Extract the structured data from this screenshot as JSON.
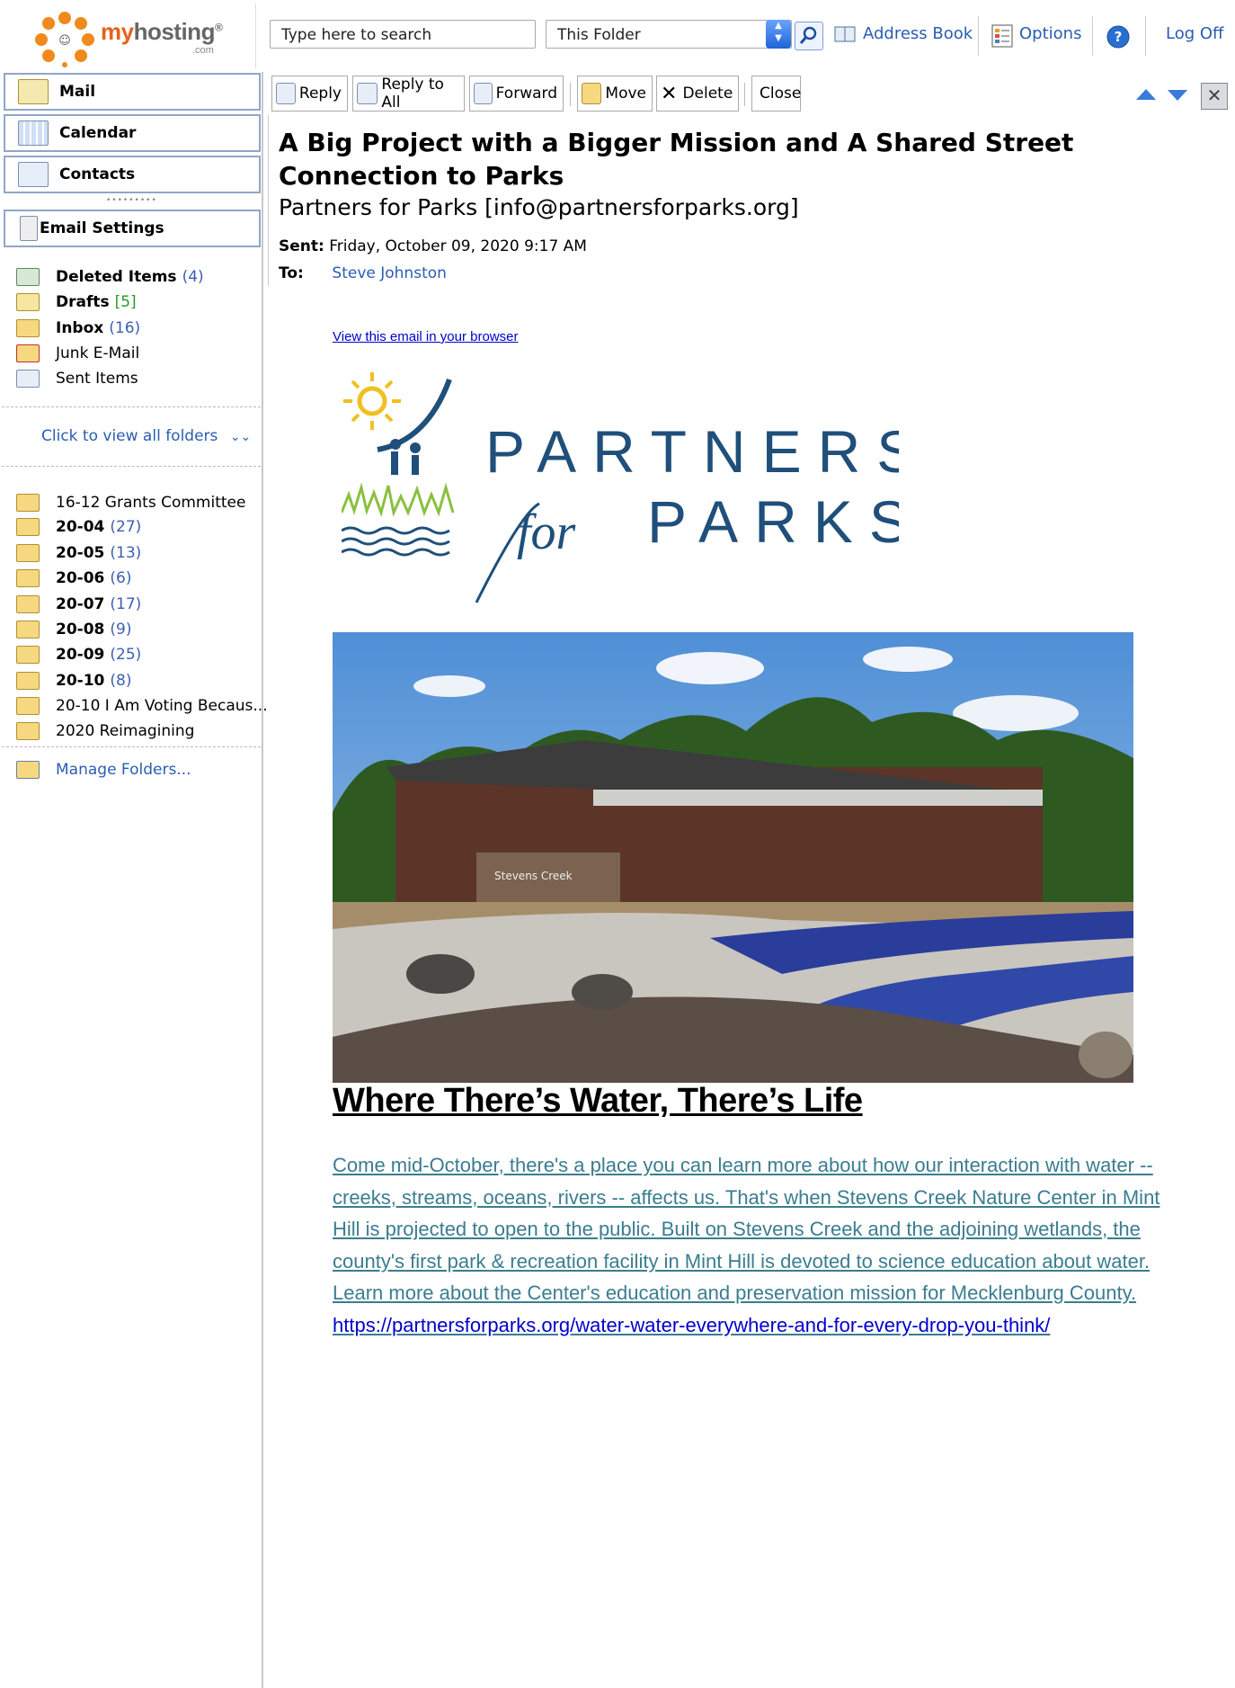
{
  "brand": {
    "name_prefix": "my",
    "name_suffix": "hosting",
    "registered": "®",
    "tld": ".com"
  },
  "search": {
    "placeholder": "Type here to search",
    "scope": "This Folder"
  },
  "toplinks": {
    "address_book": "Address Book",
    "options": "Options",
    "logoff": "Log Off"
  },
  "nav": {
    "mail": "Mail",
    "calendar": "Calendar",
    "contacts": "Contacts",
    "email_settings": "Email Settings"
  },
  "folders": [
    {
      "name": "Deleted Items",
      "count": "(4)",
      "bold": true
    },
    {
      "name": "Drafts",
      "count": "[5]",
      "bold": true
    },
    {
      "name": "Inbox",
      "count": "(16)",
      "bold": true
    },
    {
      "name": "Junk E-Mail",
      "count": "",
      "bold": false
    },
    {
      "name": "Sent Items",
      "count": "",
      "bold": false
    }
  ],
  "view_all_folders": "Click to view all folders",
  "custom_folders": [
    {
      "name": "16-12 Grants Committee",
      "count": "",
      "bold": false
    },
    {
      "name": "20-04",
      "count": "(27)",
      "bold": true
    },
    {
      "name": "20-05",
      "count": "(13)",
      "bold": true
    },
    {
      "name": "20-06",
      "count": "(6)",
      "bold": true
    },
    {
      "name": "20-07",
      "count": "(17)",
      "bold": true
    },
    {
      "name": "20-08",
      "count": "(9)",
      "bold": true
    },
    {
      "name": "20-09",
      "count": "(25)",
      "bold": true
    },
    {
      "name": "20-10",
      "count": "(8)",
      "bold": true
    },
    {
      "name": "20-10 I Am Voting Becaus...",
      "count": "",
      "bold": false
    },
    {
      "name": "2020 Reimagining",
      "count": "",
      "bold": false
    }
  ],
  "manage_folders": "Manage Folders...",
  "toolbar": {
    "reply": "Reply",
    "reply_all": "Reply to All",
    "forward": "Forward",
    "move": "Move",
    "delete": "Delete",
    "close": "Close"
  },
  "message": {
    "subject": "A Big Project with a Bigger Mission and A Shared Street Connection to Parks",
    "sender": "Partners for Parks [info@partnersforparks.org]",
    "sent_label": "Sent:",
    "sent_value": "Friday, October 09, 2020 9:17 AM",
    "to_label": "To:",
    "to_value": "Steve Johnston"
  },
  "body": {
    "view_in_browser": "View this email in your browser",
    "logo_line1": "PARTNERS",
    "logo_for": "for",
    "logo_line2": "PARKS",
    "photo_sign": "Stevens Creek",
    "headline": "Where There’s Water, There’s Life",
    "paragraph": "Come mid-October, there's a place you can learn more about how our interaction with water -- creeks, streams, oceans, rivers -- affects us. That's when Stevens Creek Nature Center in Mint Hill is projected to open to the public. Built on Stevens Creek and the adjoining wetlands, the county's first park & recreation facility in Mint Hill is devoted to science education about water. Learn more about the Center's education and preservation mission for Mecklenburg County. ",
    "link": "https://partnersforparks.org/water-water-everywhere-and-for-every-drop-you-think/"
  },
  "colors": {
    "brand_orange": "#e8601b",
    "link_blue": "#2a5db0",
    "body_teal": "#3a7d8f",
    "logo_navy": "#1f4f7a"
  }
}
